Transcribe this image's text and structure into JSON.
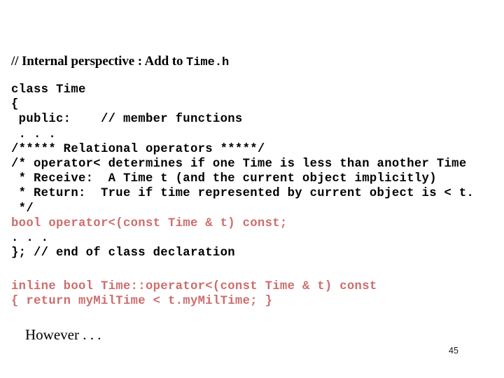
{
  "slide": {
    "page_number": "45",
    "heading": {
      "text_prefix": "// Internal perspective : Add to ",
      "text_mono": "Time.h"
    },
    "colors": {
      "background": "#ffffff",
      "text": "#000000",
      "code_red": "#cd6d6d"
    },
    "class_code": {
      "lines": [
        {
          "text": "class Time",
          "color": "black"
        },
        {
          "text": "{",
          "color": "black"
        },
        {
          "text": " public:    // member functions",
          "color": "black"
        },
        {
          "text": " . . .",
          "color": "black"
        },
        {
          "text": "/***** Relational operators *****/",
          "color": "black"
        },
        {
          "text": "/* operator< determines if one Time is less than another Time",
          "color": "black"
        },
        {
          "text": " * Receive:  A Time t (and the current object implicitly)",
          "color": "black"
        },
        {
          "text": " * Return:  True if time represented by current object is < t.",
          "color": "black"
        },
        {
          "text": " */",
          "color": "black"
        },
        {
          "text": "bool operator<(const Time & t) const;",
          "color": "red"
        },
        {
          "text": ". . .",
          "color": "black"
        },
        {
          "text": "}; // end of class declaration",
          "color": "black"
        }
      ]
    },
    "inline_code": {
      "lines": [
        {
          "text": "inline bool Time::operator<(const Time & t) const",
          "color": "red"
        },
        {
          "text": "{ return myMilTime < t.myMilTime; }",
          "color": "red"
        }
      ]
    },
    "however_text": "However . . ."
  }
}
